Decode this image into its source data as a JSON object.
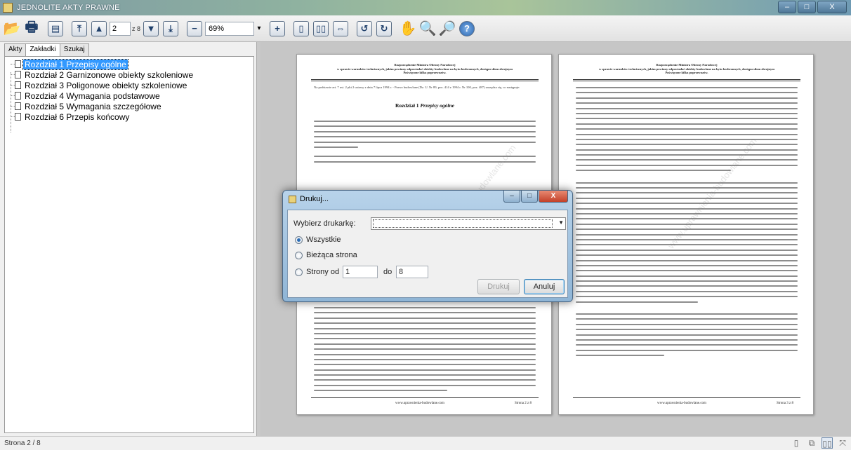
{
  "window": {
    "title": "JEDNOLITE AKTY PRAWNE",
    "min_label": "–",
    "max_label": "□",
    "close_label": "X"
  },
  "toolbar": {
    "current_page": "2",
    "total_pages_label": "z 8",
    "zoom": "69%",
    "zoom_arrow": "▾",
    "buttons": [
      {
        "name": "open-folder-icon",
        "glyph": "📂"
      },
      {
        "name": "print-icon",
        "glyph": "🖶"
      },
      {
        "name": "page-view-icon",
        "glyph": "▤"
      },
      {
        "name": "first-page-icon",
        "glyph": "⤒"
      },
      {
        "name": "prev-page-icon",
        "glyph": "▲"
      },
      {
        "name": "next-page-icon",
        "glyph": "▼"
      },
      {
        "name": "last-page-icon",
        "glyph": "⤓"
      },
      {
        "name": "zoom-out-icon",
        "glyph": "−"
      },
      {
        "name": "zoom-in-icon",
        "glyph": "+"
      },
      {
        "name": "single-page-icon",
        "glyph": "▯"
      },
      {
        "name": "two-page-icon",
        "glyph": "▯▯"
      },
      {
        "name": "fit-width-icon",
        "glyph": "⇔"
      },
      {
        "name": "rotate-left-icon",
        "glyph": "↺"
      },
      {
        "name": "rotate-right-icon",
        "glyph": "↻"
      },
      {
        "name": "hand-tool-icon",
        "glyph": "✋"
      },
      {
        "name": "zoom-tool-icon",
        "glyph": "🔍"
      },
      {
        "name": "zoom-tool-plus-icon",
        "glyph": "🔎"
      },
      {
        "name": "help-icon",
        "glyph": "?"
      }
    ]
  },
  "left_panel": {
    "tabs": [
      "Akty",
      "Zakładki",
      "Szukaj"
    ],
    "active_tab": 1,
    "tree": [
      {
        "label": "Rozdział 1  Przepisy ogólne",
        "selected": true
      },
      {
        "label": "Rozdział 2  Garnizonowe obiekty szkoleniowe",
        "selected": false
      },
      {
        "label": "Rozdział 3  Poligonowe obiekty szkoleniowe",
        "selected": false
      },
      {
        "label": "Rozdział 4  Wymagania podstawowe",
        "selected": false
      },
      {
        "label": "Rozdział 5  Wymagania szczegółowe",
        "selected": false
      },
      {
        "label": "Rozdział 6  Przepis końcowy",
        "selected": false
      }
    ]
  },
  "document": {
    "pages": [
      {
        "head": [
          "Rozporządzenie Ministra Obrony Narodowej",
          "w sprawie warunków technicznych, jakim powinny odpowiadać obiekty budowlane na bytu bezbronnych, dostępu siłom zbrojnym",
          "Poświęcone kilka poprzewozów."
        ],
        "intro": "Na podstawie art. 7 ust. 2 pkt 2 ustawy z dnia 7 lipca 1994 r. - Prawo budowlane (Dz. U. Nr 89, poz. 414 z 1994 r. Nr 100, poz. 487) zarządza się, co następuje:",
        "chapter_prefix": "Rozdział 1",
        "chapter_title": "Przepisy ogólne",
        "footer_url": "www.uprawnienia-budowlane.com",
        "footer_page": "Strona 2 z 8"
      },
      {
        "head": [
          "Rozporządzenie Ministra Obrony Narodowej",
          "w sprawie warunków technicznych, jakim powinny odpowiadać obiekty budowlane na bytu bezbronnych, dostępu siłom zbrojnym",
          "Poświęcone kilka poprzewozów."
        ],
        "footer_url": "www.uprawnienia-budowlane.com",
        "footer_page": "Strona 3 z 8"
      }
    ],
    "watermark": "www.uprawnienia-budowlane.com"
  },
  "dialog": {
    "title": "Drukuj...",
    "printer_label": "Wybierz drukarkę:",
    "options": [
      {
        "label": "Wszystkie",
        "checked": true
      },
      {
        "label": "Bieżąca strona",
        "checked": false
      },
      {
        "label": "Strony od",
        "checked": false
      }
    ],
    "from_value": "1",
    "to_label": "do",
    "to_value": "8",
    "print_button": "Drukuj",
    "cancel_button": "Anuluj"
  },
  "status": {
    "text": "Strona 2 / 8"
  },
  "view_buttons": [
    {
      "name": "single-page-view-icon",
      "glyph": "▯"
    },
    {
      "name": "continuous-view-icon",
      "glyph": "⧉"
    },
    {
      "name": "two-page-view-icon",
      "glyph": "▯▯"
    },
    {
      "name": "fullscreen-view-icon",
      "glyph": "⤧"
    }
  ]
}
